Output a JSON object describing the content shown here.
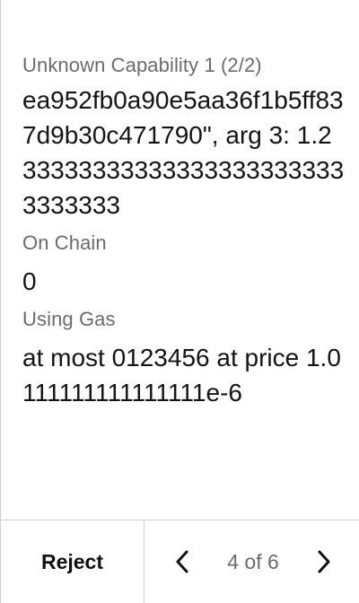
{
  "capability": {
    "label": "Unknown Capability 1 (2/2)",
    "value": "ea952fb0a90e5aa36f1b5ff837d9b30c471790\", arg 3: 1.2333333333333333333333333333333"
  },
  "on_chain": {
    "label": "On Chain",
    "value": "0"
  },
  "gas": {
    "label": "Using Gas",
    "value": "at most 0123456 at price 1.0111111111111111e-6"
  },
  "footer": {
    "reject_label": "Reject",
    "page_indicator": "4 of 6",
    "prev_icon": "chevron-left-icon",
    "next_icon": "chevron-right-icon"
  }
}
